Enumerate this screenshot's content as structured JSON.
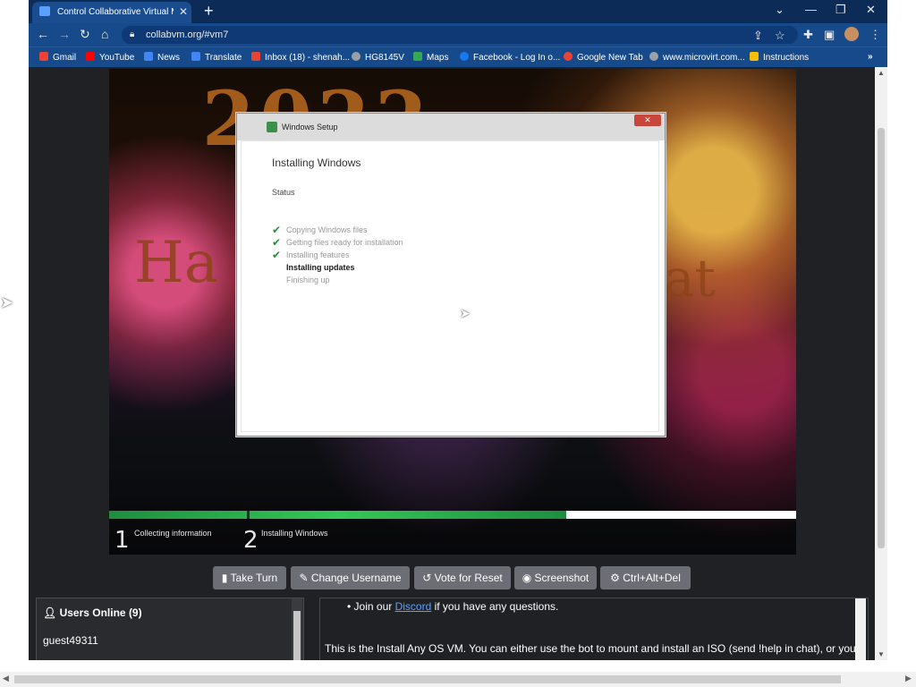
{
  "browser": {
    "tab_title": "Control Collaborative Virtual Ma...",
    "url": "collabvm.org/#vm7"
  },
  "bookmarks": [
    {
      "label": "Gmail",
      "color": "#ea4335"
    },
    {
      "label": "YouTube",
      "color": "#ff0000"
    },
    {
      "label": "News",
      "color": "#4285f4"
    },
    {
      "label": "Translate",
      "color": "#4285f4"
    },
    {
      "label": "Inbox (18) - shenah...",
      "color": "#ea4335"
    },
    {
      "label": "HG8145V",
      "color": "#9aa0a6"
    },
    {
      "label": "Maps",
      "color": "#34a853"
    },
    {
      "label": "Facebook - Log In o...",
      "color": "#1877f2"
    },
    {
      "label": "Google New Tab",
      "color": "#ea4335"
    },
    {
      "label": "www.microvirt.com...",
      "color": "#9aa0a6"
    },
    {
      "label": "Instructions",
      "color": "#fbbc04"
    }
  ],
  "vm": {
    "wallpaper_text": "2022",
    "setup_dialog": {
      "window_title": "Windows Setup",
      "heading": "Installing Windows",
      "status_label": "Status",
      "steps": [
        {
          "label": "Copying Windows files",
          "state": "done"
        },
        {
          "label": "Getting files ready for installation",
          "state": "done"
        },
        {
          "label": "Installing features",
          "state": "done"
        },
        {
          "label": "Installing updates",
          "state": "active"
        },
        {
          "label": "Finishing up",
          "state": "pending"
        }
      ]
    },
    "progress": {
      "fraction": 0.665,
      "phases": [
        {
          "num": "1",
          "label": "Collecting information"
        },
        {
          "num": "2",
          "label": "Installing Windows"
        }
      ]
    }
  },
  "actions": [
    {
      "label": "Take Turn",
      "icon": "take-turn-icon"
    },
    {
      "label": "Change Username",
      "icon": "change-username-icon"
    },
    {
      "label": "Vote for Reset",
      "icon": "vote-reset-icon"
    },
    {
      "label": "Screenshot",
      "icon": "camera-icon"
    },
    {
      "label": "Ctrl+Alt+Del",
      "icon": "gear-icon"
    }
  ],
  "users_panel": {
    "title": "Users Online (9)",
    "users": [
      "guest49311"
    ]
  },
  "chat": {
    "bullet_prefix": "Join our ",
    "bullet_link": "Discord",
    "bullet_suffix": " if you have any questions.",
    "body": "This is the Install Any OS VM. You can either use the bot to mount and install an ISO (send !help in chat), or you c"
  }
}
